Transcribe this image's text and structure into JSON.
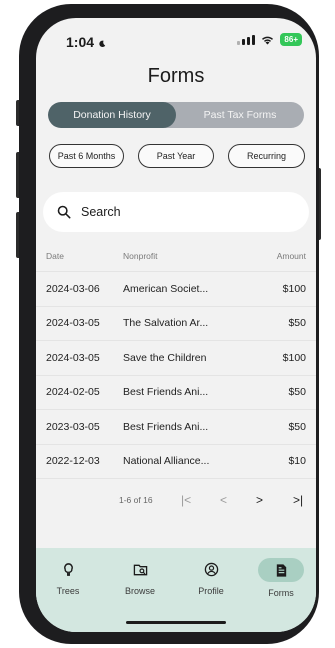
{
  "status_bar": {
    "time": "1:04",
    "battery": "86+"
  },
  "page": {
    "title": "Forms"
  },
  "segments": [
    {
      "label": "Donation History",
      "active": true
    },
    {
      "label": "Past Tax Forms",
      "active": false
    }
  ],
  "filters": [
    "Past 6 Months",
    "Past Year",
    "Recurring"
  ],
  "search": {
    "placeholder": "Search"
  },
  "table": {
    "headers": {
      "date": "Date",
      "nonprofit": "Nonprofit",
      "amount": "Amount"
    },
    "rows": [
      {
        "date": "2024-03-06",
        "nonprofit": "American Societ...",
        "amount": "$100"
      },
      {
        "date": "2024-03-05",
        "nonprofit": "The Salvation Ar...",
        "amount": "$50"
      },
      {
        "date": "2024-03-05",
        "nonprofit": "Save the Children",
        "amount": "$100"
      },
      {
        "date": "2024-02-05",
        "nonprofit": "Best Friends Ani...",
        "amount": "$50"
      },
      {
        "date": "2023-03-05",
        "nonprofit": "Best Friends Ani...",
        "amount": "$50"
      },
      {
        "date": "2022-12-03",
        "nonprofit": "National Alliance...",
        "amount": "$10"
      }
    ]
  },
  "pagination": {
    "range": "1-6 of 16",
    "first": "|<",
    "prev": "<",
    "next": ">",
    "last": ">|"
  },
  "nav": [
    {
      "label": "Trees",
      "icon": "tree-icon"
    },
    {
      "label": "Browse",
      "icon": "browse-icon"
    },
    {
      "label": "Profile",
      "icon": "profile-icon"
    },
    {
      "label": "Forms",
      "icon": "forms-icon",
      "active": true
    }
  ]
}
